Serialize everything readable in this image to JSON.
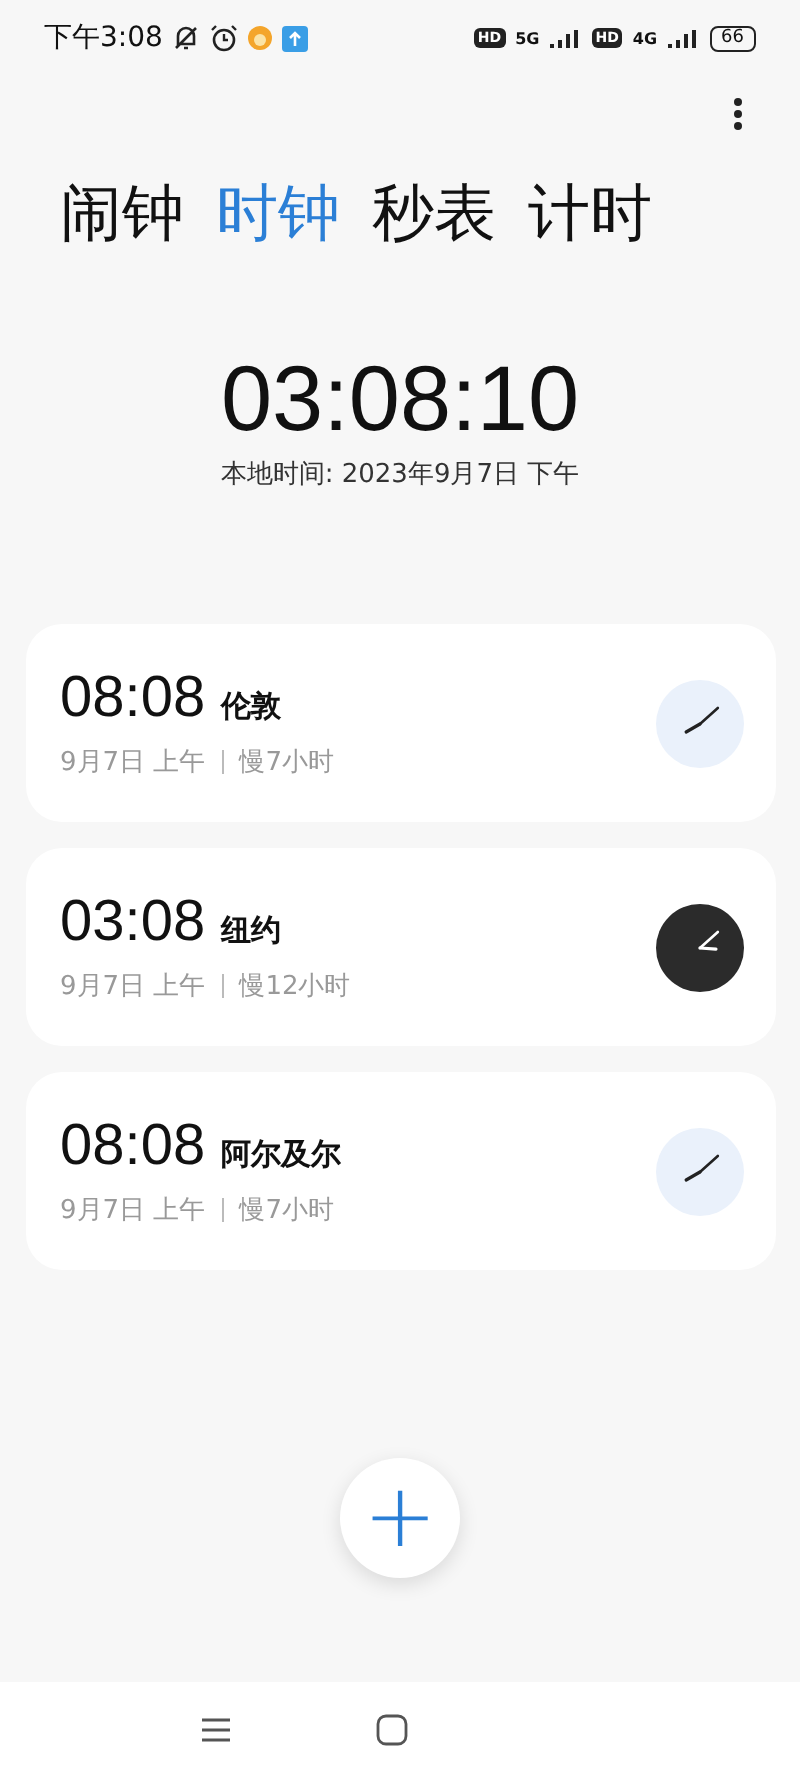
{
  "status_bar": {
    "time": "下午3:08",
    "network_1": "5G",
    "network_2": "4G",
    "hd_1": "HD",
    "hd_2": "HD",
    "battery": "66"
  },
  "tabs": [
    {
      "label": "闹钟",
      "selected": false
    },
    {
      "label": "时钟",
      "selected": true
    },
    {
      "label": "秒表",
      "selected": false
    },
    {
      "label": "计时",
      "selected": false
    }
  ],
  "local_clock": {
    "time": "03:08:10",
    "caption": "本地时间: 2023年9月7日 下午"
  },
  "cities": [
    {
      "time": "08:08",
      "city": "伦敦",
      "date": "9月7日 上午",
      "offset": "慢7小时",
      "kind": "day"
    },
    {
      "time": "03:08",
      "city": "纽约",
      "date": "9月7日 上午",
      "offset": "慢12小时",
      "kind": "night"
    },
    {
      "time": "08:08",
      "city": "阿尔及尔",
      "date": "9月7日 上午",
      "offset": "慢7小时",
      "kind": "day"
    }
  ],
  "add_button": {
    "symbol": "+"
  }
}
